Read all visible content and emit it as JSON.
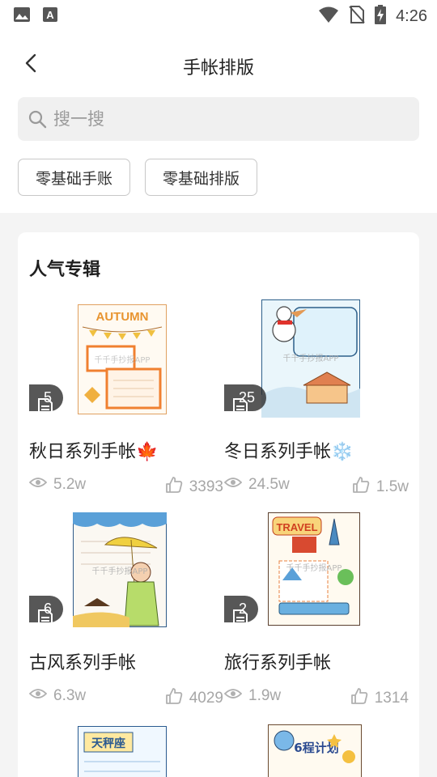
{
  "status_bar": {
    "time": "4:26",
    "left_icons": [
      "image-icon",
      "text-a-icon"
    ],
    "right_icons": [
      "wifi-icon",
      "no-sim-icon",
      "battery-charging-icon"
    ]
  },
  "header": {
    "title": "手帐排版",
    "back_icon": "chevron-left-icon"
  },
  "search": {
    "placeholder": "搜一搜",
    "icon": "search-icon"
  },
  "tags": [
    {
      "label": "零基础手账"
    },
    {
      "label": "零基础排版"
    }
  ],
  "section": {
    "title": "人气专辑"
  },
  "cards": [
    {
      "title": "秋日系列手帐🍁",
      "count": "5",
      "views": "5.2w",
      "likes": "3393"
    },
    {
      "title": "冬日系列手帐❄️",
      "count": "25",
      "views": "24.5w",
      "likes": "1.5w"
    },
    {
      "title": "古风系列手帐",
      "count": "6",
      "views": "6.3w",
      "likes": "4029"
    },
    {
      "title": "旅行系列手帐",
      "count": "2",
      "views": "1.9w",
      "likes": "1314"
    }
  ],
  "thumbnail_text": {
    "autumn": "AUTUMN",
    "travel": "TRAVEL",
    "watermark": "千千手抄报APP",
    "tianchengzuo": "天秤座",
    "plan": "6程计划"
  },
  "colors": {
    "accent_orange": "#f0a030",
    "badge_bg": "#333333",
    "stat_gray": "#a6a6a6"
  }
}
